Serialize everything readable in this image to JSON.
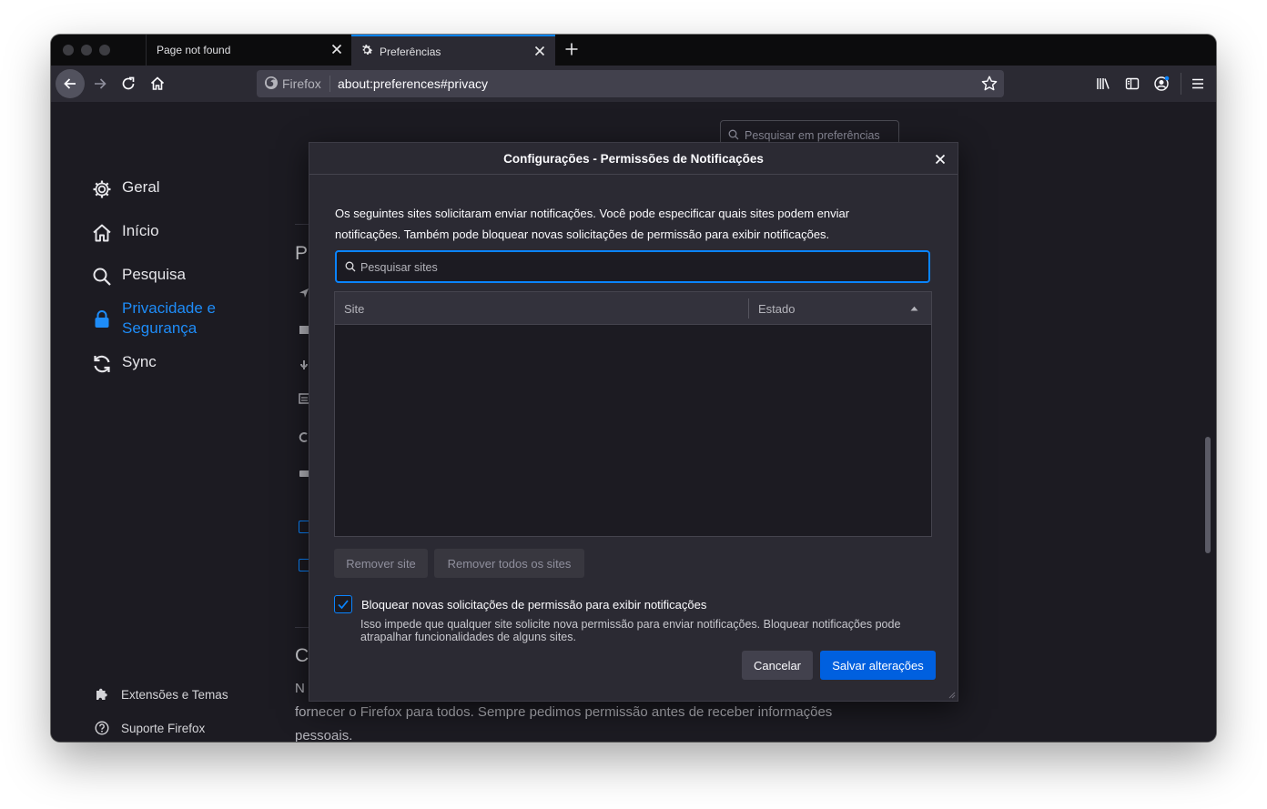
{
  "browser": {
    "tabs": [
      {
        "title": "Page not found",
        "active": false
      },
      {
        "title": "Preferências",
        "active": true,
        "icon": "gear-icon"
      }
    ],
    "urlbar": {
      "identity_label": "Firefox",
      "url": "about:preferences#privacy"
    }
  },
  "preferences": {
    "search_placeholder": "Pesquisar em preferências",
    "sidebar": {
      "items": [
        {
          "label": "Geral",
          "icon": "gear-icon"
        },
        {
          "label": "Início",
          "icon": "home-icon"
        },
        {
          "label": "Pesquisa",
          "icon": "search-icon"
        },
        {
          "label": "Privacidade e Segurança",
          "icon": "lock-icon",
          "active": true
        },
        {
          "label": "Sync",
          "icon": "sync-icon"
        }
      ],
      "footer": [
        {
          "label": "Extensões e Temas",
          "icon": "puzzle-icon"
        },
        {
          "label": "Suporte Firefox",
          "icon": "help-icon"
        }
      ]
    },
    "background": {
      "heading_partial_1": "P",
      "heading_partial_2": "C",
      "text_partial": "N",
      "text_line_2": "fornecer o Firefox para todos. Sempre pedimos permissão antes de receber informações",
      "text_line_3": "pessoais."
    }
  },
  "dialog": {
    "title": "Configurações - Permissões de Notificações",
    "description": "Os seguintes sites solicitaram enviar notificações. Você pode especificar quais sites podem enviar notificações. Também pode bloquear novas solicitações de permissão para exibir notificações.",
    "search_placeholder": "Pesquisar sites",
    "table": {
      "columns": [
        "Site",
        "Estado"
      ],
      "rows": []
    },
    "remove_site_label": "Remover site",
    "remove_all_label": "Remover todos os sites",
    "block_checkbox": {
      "checked": true,
      "label": "Bloquear novas solicitações de permissão para exibir notificações",
      "description": "Isso impede que qualquer site solicite nova permissão para enviar notificações. Bloquear notificações pode atrapalhar funcionalidades de alguns sites."
    },
    "cancel_label": "Cancelar",
    "save_label": "Salvar alterações"
  },
  "colors": {
    "accent": "#0a84ff",
    "primary_button": "#0060df",
    "active_sidebar": "#1e8cf8",
    "background": "#1c1b22",
    "dialog_background": "#2b2a33"
  }
}
